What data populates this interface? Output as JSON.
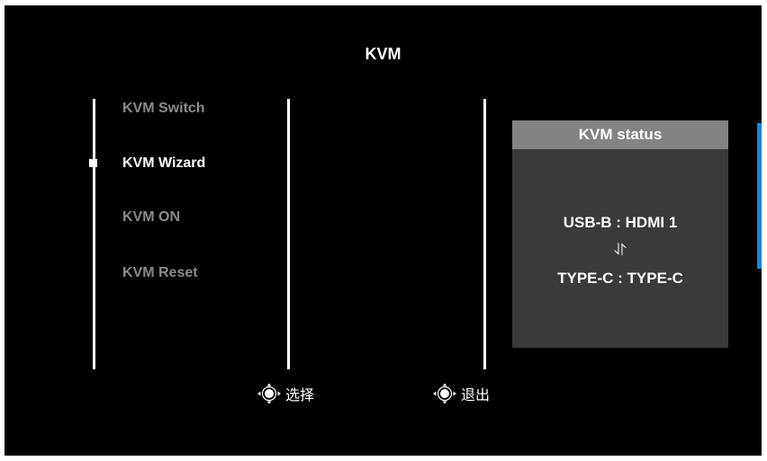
{
  "title": "KVM",
  "menu": {
    "items": [
      {
        "label": "KVM Switch",
        "active": false
      },
      {
        "label": "KVM Wizard",
        "active": true
      },
      {
        "label": "KVM ON",
        "active": false
      },
      {
        "label": "KVM Reset",
        "active": false
      }
    ]
  },
  "status": {
    "header": "KVM status",
    "line1": "USB-B : HDMI 1",
    "swap_glyph": "⥯",
    "line2": "TYPE-C : TYPE-C"
  },
  "hints": {
    "select_label": "选择",
    "exit_label": "退出",
    "select_icon": "joystick-move-icon",
    "exit_icon": "joystick-left-icon"
  },
  "colors": {
    "background": "#000000",
    "accent": "#1e86d2",
    "inactive_text": "#8a8a8a",
    "panel": "#3a3a3a",
    "panel_header": "#838383"
  }
}
